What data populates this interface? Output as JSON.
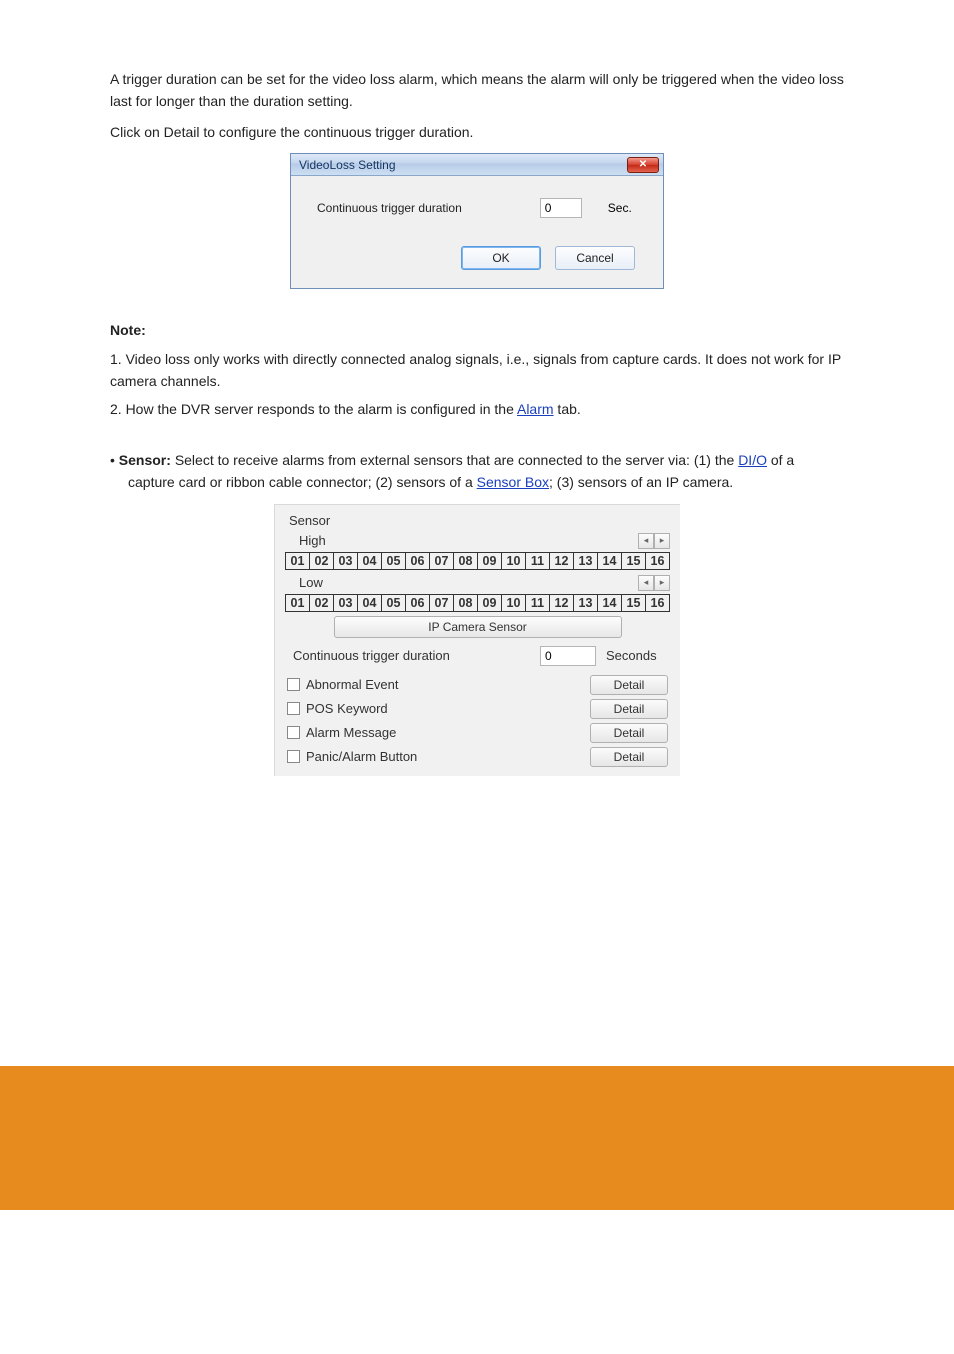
{
  "page": {
    "para1": "A trigger duration can be set for the video loss alarm, which means the alarm will only be triggered when the video loss last for longer than the duration setting.",
    "para2": "Click on Detail to configure the continuous trigger duration.",
    "notes_lead": "Note:",
    "note1": "1. Video loss only works with directly connected analog signals, i.e., signals from capture cards. It does not work for IP camera channels.",
    "note2_part1": "2. How the DVR server responds to the alarm is configured in the ",
    "note2_link": "Alarm",
    "note2_part2": " tab.",
    "section_sensor": "Sensor: ",
    "section_sensor_desc": "Select to receive alarms from external sensors that are connected to the server via: (1) the ",
    "section_sensor_desc2": " of a capture card or ribbon cable connector; (2) sensors of a ",
    "section_sensor_desc3": "; (3) sensors of an IP camera.",
    "dio_link": "DI/O",
    "sensor_box_link": "Sensor Box"
  },
  "videoloss_dialog": {
    "title": "VideoLoss Setting",
    "label": "Continuous trigger duration",
    "value": "0",
    "sec": "Sec.",
    "ok": "OK",
    "cancel": "Cancel"
  },
  "sensor_panel": {
    "title": "Sensor",
    "high": "High",
    "low": "Low",
    "nums": [
      "01",
      "02",
      "03",
      "04",
      "05",
      "06",
      "07",
      "08",
      "09",
      "10",
      "11",
      "12",
      "13",
      "14",
      "15",
      "16"
    ],
    "ip_button": "IP Camera Sensor",
    "ctd_label": "Continuous trigger duration",
    "ctd_value": "0",
    "ctd_unit": "Seconds",
    "rows": [
      {
        "label": "Abnormal Event",
        "btn": "Detail"
      },
      {
        "label": "POS Keyword",
        "btn": "Detail"
      },
      {
        "label": "Alarm Message",
        "btn": "Detail"
      },
      {
        "label": "Panic/Alarm Button",
        "btn": "Detail"
      }
    ]
  }
}
